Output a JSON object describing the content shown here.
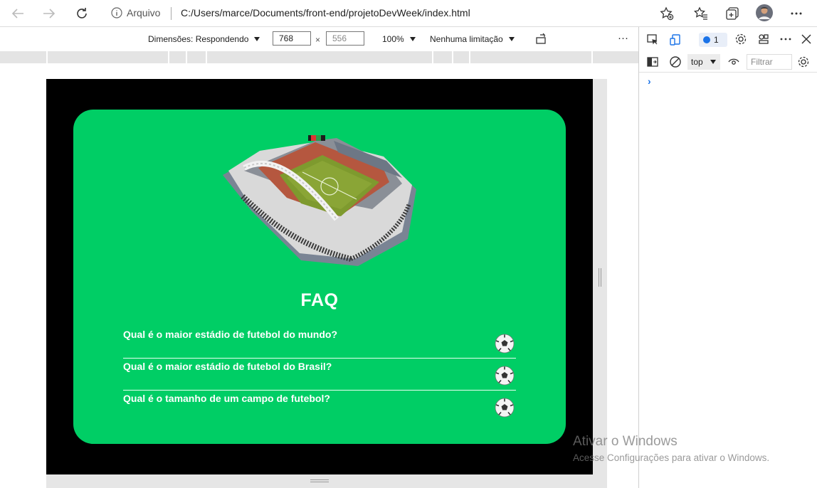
{
  "browser": {
    "site_info_label": "Arquivo",
    "url": "C:/Users/marce/Documents/front-end/projetoDevWeek/index.html"
  },
  "device_toolbar": {
    "dimensions_label": "Dimensões: Respondendo",
    "width_value": "768",
    "times_sign": "×",
    "height_value": "556",
    "zoom_label": "100%",
    "throttle_label": "Nenhuma limitação",
    "more_label": "···"
  },
  "faq": {
    "title": "FAQ",
    "questions": [
      "Qual é o maior estádio de futebol do mundo?",
      "Qual é o maior estádio de futebol do Brasil?",
      "Qual é o tamanho de um campo de futebol?"
    ]
  },
  "devtools": {
    "issues_count": "1",
    "context_label": "top",
    "filter_placeholder": "Filtrar",
    "prompt_symbol": "›"
  },
  "activation": {
    "title": "Ativar o Windows",
    "subtitle": "Acesse Configurações para ativar o Windows."
  },
  "colors": {
    "card_green": "#00ce65",
    "page_background": "#000000",
    "devtools_accent": "#1a73e8"
  },
  "icons": [
    "back-icon",
    "forward-icon",
    "refresh-icon",
    "info-icon",
    "favorite-add-icon",
    "favorites-icon",
    "collections-icon",
    "profile-avatar",
    "more-icon",
    "device-toggle-icon",
    "rotate-icon",
    "inspect-icon",
    "close-icon",
    "settings-icon",
    "soccer-ball-icon",
    "stadium-image"
  ]
}
